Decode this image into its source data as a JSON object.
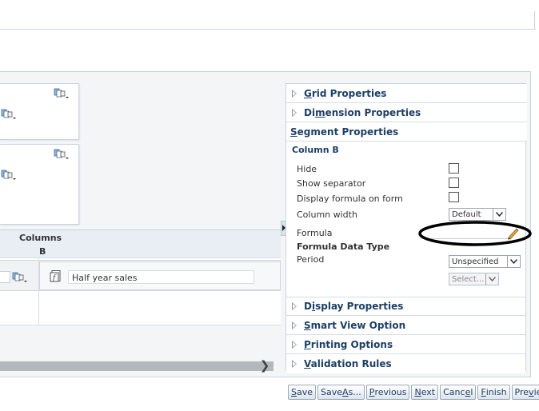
{
  "grid": {
    "columns_header": "Columns",
    "column_letter": "B",
    "formula_cell_value": "Half year sales"
  },
  "right_panel": {
    "sections_top": [
      {
        "label": "Grid Properties",
        "ul": "G",
        "rest": "rid Properties"
      },
      {
        "label": "Dimension Properties",
        "pre": "Di",
        "ul": "m",
        "rest": "ension Properties"
      }
    ],
    "segment_header": {
      "ul": "S",
      "rest": "egment Properties"
    },
    "column_title": "Column B",
    "props": {
      "hide": "Hide",
      "show_separator": "Show separator",
      "display_formula": "Display formula on form",
      "column_width": "Column width",
      "column_width_value": "Default",
      "formula": "Formula",
      "formula_data_type": "Formula Data Type",
      "period": "Period",
      "period_value": "Unspecified",
      "select_placeholder": "Select..."
    },
    "sections_bottom": [
      {
        "pre": "D",
        "ul": "i",
        "rest": "splay Properties"
      },
      {
        "pre": "",
        "ul": "S",
        "rest": "mart View Option"
      },
      {
        "pre": "",
        "ul": "P",
        "rest": "rinting Options"
      },
      {
        "pre": "",
        "ul": "V",
        "rest": "alidation Rules"
      }
    ]
  },
  "buttons": [
    {
      "pre": "",
      "ul": "S",
      "rest": "ave"
    },
    {
      "pre": "Save ",
      "ul": "A",
      "rest": "s..."
    },
    {
      "pre": "",
      "ul": "P",
      "rest": "revious"
    },
    {
      "pre": "",
      "ul": "N",
      "rest": "ext"
    },
    {
      "pre": "Canc",
      "ul": "e",
      "rest": "l"
    },
    {
      "pre": "",
      "ul": "F",
      "rest": "inish"
    },
    {
      "pre": "Pre",
      "ul": "v",
      "rest": "iew"
    }
  ],
  "icons": {
    "member_selector": "member-selector-icon",
    "formula": "formula-icon",
    "dropdown": "chevron-down-icon",
    "pencil": "pencil-icon"
  },
  "colors": {
    "accent_text": "#1e3f66",
    "panel_bg": "#f3f5f7",
    "annotation_ellipse": "#000000"
  }
}
